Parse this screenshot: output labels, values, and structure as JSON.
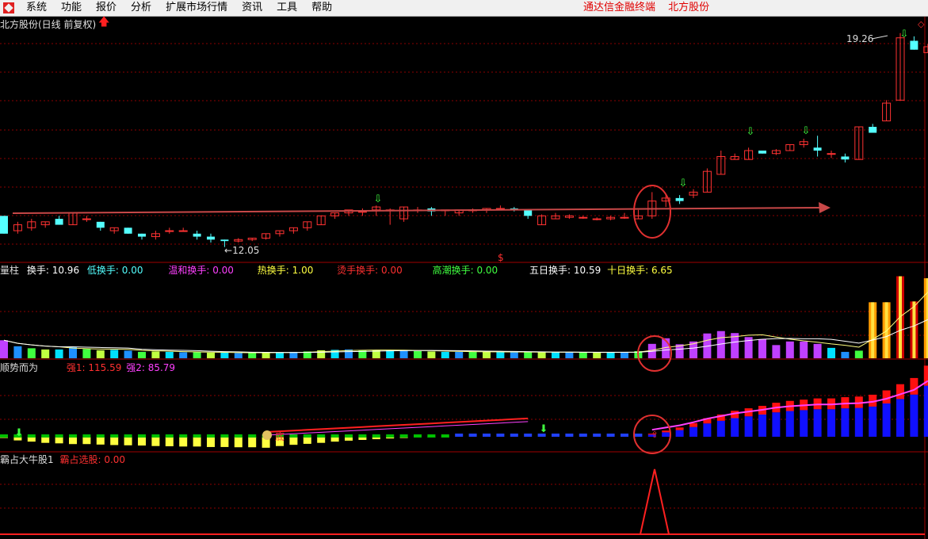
{
  "menu": {
    "items": [
      "系统",
      "功能",
      "报价",
      "分析",
      "扩展市场行情",
      "资讯",
      "工具",
      "帮助"
    ],
    "terminal_title": "通达信金融终端",
    "stock_name_title": "北方股份"
  },
  "colors": {
    "up": "#ff3232",
    "down": "#54ffff",
    "grid": "#8b0000",
    "trend_arrow": "#c84848"
  },
  "main_panel": {
    "title": "北方股份(日线 前复权)",
    "high_label": "19.26",
    "low_label": "12.05",
    "marker": "$"
  },
  "volume_panel": {
    "name": "量柱",
    "labels": [
      {
        "label": "换手:",
        "value": "10.96",
        "color": "#ffffff"
      },
      {
        "label": "低换手:",
        "value": "0.00",
        "color": "#54ffff"
      },
      {
        "label": "温和换手:",
        "value": "0.00",
        "color": "#ff40ff"
      },
      {
        "label": "热换手:",
        "value": "1.00",
        "color": "#ffff40"
      },
      {
        "label": "烫手换手:",
        "value": "0.00",
        "color": "#ff3030"
      },
      {
        "label": "高潮换手:",
        "value": "0.00",
        "color": "#40ff40"
      },
      {
        "label": "五日换手:",
        "value": "10.59",
        "color": "#ffffff"
      },
      {
        "label": "十日换手:",
        "value": "6.65",
        "color": "#ffff40"
      }
    ]
  },
  "trend_panel": {
    "name": "顺势而为",
    "strong1_label": "强1:",
    "strong1_value": "115.59",
    "strong2_label": "强2:",
    "strong2_value": "85.79",
    "tag": "底"
  },
  "bull_panel": {
    "name": "霸占大牛股1",
    "signal_label": "霸占选股:",
    "signal_value": "0.00"
  },
  "chart_data": {
    "type": "candlestick",
    "price_range": [
      11.8,
      19.6
    ],
    "series": [
      {
        "name": "price",
        "ohlc": [
          [
            13.1,
            13.1,
            12.5,
            12.5
          ],
          [
            12.6,
            12.9,
            12.5,
            12.8
          ],
          [
            12.7,
            13.0,
            12.6,
            12.9
          ],
          [
            12.8,
            12.9,
            12.7,
            12.9
          ],
          [
            13.0,
            13.1,
            12.8,
            12.8
          ],
          [
            12.8,
            13.2,
            12.8,
            13.2
          ],
          [
            13.0,
            13.1,
            12.9,
            13.0
          ],
          [
            12.9,
            12.9,
            12.6,
            12.7
          ],
          [
            12.6,
            12.7,
            12.5,
            12.7
          ],
          [
            12.7,
            12.7,
            12.5,
            12.5
          ],
          [
            12.5,
            12.5,
            12.3,
            12.4
          ],
          [
            12.4,
            12.6,
            12.3,
            12.5
          ],
          [
            12.6,
            12.7,
            12.5,
            12.6
          ],
          [
            12.6,
            12.7,
            12.6,
            12.6
          ],
          [
            12.5,
            12.6,
            12.3,
            12.4
          ],
          [
            12.4,
            12.5,
            12.2,
            12.3
          ],
          [
            12.3,
            12.3,
            12.05,
            12.25
          ],
          [
            12.25,
            12.35,
            12.2,
            12.3
          ],
          [
            12.3,
            12.35,
            12.25,
            12.35
          ],
          [
            12.35,
            12.5,
            12.3,
            12.5
          ],
          [
            12.5,
            12.6,
            12.4,
            12.6
          ],
          [
            12.6,
            12.7,
            12.5,
            12.7
          ],
          [
            12.7,
            12.9,
            12.6,
            12.9
          ],
          [
            12.8,
            13.1,
            12.8,
            13.1
          ],
          [
            13.1,
            13.2,
            13.0,
            13.2
          ],
          [
            13.2,
            13.3,
            13.1,
            13.3
          ],
          [
            13.25,
            13.35,
            13.1,
            13.25
          ],
          [
            13.3,
            13.45,
            13.1,
            13.4
          ],
          [
            13.3,
            13.35,
            12.8,
            13.3
          ],
          [
            13.0,
            13.4,
            12.9,
            13.4
          ],
          [
            13.3,
            13.4,
            13.2,
            13.3
          ],
          [
            13.35,
            13.4,
            13.1,
            13.25
          ],
          [
            13.3,
            13.3,
            13.1,
            13.3
          ],
          [
            13.2,
            13.3,
            13.1,
            13.3
          ],
          [
            13.3,
            13.35,
            13.2,
            13.3
          ],
          [
            13.3,
            13.35,
            13.2,
            13.35
          ],
          [
            13.35,
            13.45,
            13.3,
            13.35
          ],
          [
            13.35,
            13.4,
            13.25,
            13.3
          ],
          [
            13.3,
            13.3,
            13.0,
            13.1
          ],
          [
            12.8,
            13.15,
            12.8,
            13.1
          ],
          [
            13.0,
            13.2,
            13.0,
            13.1
          ],
          [
            13.05,
            13.15,
            13.0,
            13.1
          ],
          [
            13.05,
            13.1,
            13.0,
            13.05
          ],
          [
            13.0,
            13.05,
            12.95,
            13.0
          ],
          [
            13.0,
            13.1,
            12.95,
            13.05
          ],
          [
            13.05,
            13.2,
            13.0,
            13.05
          ],
          [
            13.0,
            13.3,
            13.0,
            13.1
          ],
          [
            13.1,
            13.9,
            13.0,
            13.6
          ],
          [
            13.6,
            13.8,
            13.4,
            13.7
          ],
          [
            13.7,
            13.8,
            13.5,
            13.6
          ],
          [
            13.8,
            14.0,
            13.7,
            13.9
          ],
          [
            13.9,
            14.7,
            13.9,
            14.6
          ],
          [
            14.5,
            15.3,
            14.5,
            15.1
          ],
          [
            15.0,
            15.2,
            15.0,
            15.1
          ],
          [
            15.0,
            15.4,
            15.0,
            15.3
          ],
          [
            15.3,
            15.3,
            15.2,
            15.2
          ],
          [
            15.2,
            15.35,
            15.15,
            15.3
          ],
          [
            15.3,
            15.5,
            15.3,
            15.5
          ],
          [
            15.5,
            15.7,
            15.4,
            15.6
          ],
          [
            15.4,
            15.8,
            15.1,
            15.3
          ],
          [
            15.2,
            15.3,
            15.05,
            15.2
          ],
          [
            15.1,
            15.2,
            14.9,
            15.0
          ],
          [
            15.0,
            16.1,
            15.0,
            16.1
          ],
          [
            16.1,
            16.2,
            15.9,
            15.9
          ],
          [
            16.3,
            17.0,
            16.3,
            16.9
          ],
          [
            17.0,
            19.26,
            17.0,
            19.1
          ],
          [
            19.0,
            19.15,
            18.7,
            18.7
          ],
          [
            18.6,
            18.9,
            18.6,
            18.8
          ]
        ]
      },
      {
        "name": "volume_bars",
        "values": [
          4.5,
          3.0,
          2.5,
          2.2,
          2.2,
          2.8,
          2.3,
          2.0,
          2.1,
          1.9,
          1.6,
          1.7,
          1.6,
          1.5,
          1.5,
          1.4,
          1.4,
          1.3,
          1.3,
          1.5,
          1.5,
          1.6,
          1.7,
          2.0,
          2.1,
          2.2,
          2.0,
          2.0,
          2.0,
          2.0,
          1.8,
          1.7,
          1.6,
          1.6,
          1.6,
          1.6,
          1.6,
          1.5,
          1.5,
          1.5,
          1.5,
          1.5,
          1.4,
          1.4,
          1.5,
          1.6,
          1.8,
          3.6,
          5.0,
          3.5,
          4.2,
          6.2,
          6.8,
          6.3,
          5.3,
          4.8,
          3.3,
          4.2,
          4.2,
          3.6,
          2.6,
          1.6,
          1.9,
          14.0,
          14.0,
          20.5,
          14.2,
          20.0
        ]
      },
      {
        "name": "strength_bars",
        "values": [
          -0.5,
          -1.5,
          -2,
          -2.5,
          -2.7,
          -3,
          -3,
          -3.2,
          -3.4,
          -3.5,
          -3.6,
          -3.8,
          -3.9,
          -4,
          -4,
          -4.2,
          -4.2,
          -4.3,
          -4.3,
          -4.5,
          -3.8,
          -3.3,
          -2.9,
          -2.5,
          -2.0,
          -1.6,
          -1.3,
          -1.0,
          -0.7,
          -0.5,
          -0.3,
          -0.2,
          -0.1,
          0,
          0,
          0.1,
          0.1,
          0.2,
          0.2,
          0.1,
          0.0,
          0.0,
          0.0,
          0.0,
          0.0,
          0.1,
          0.2,
          0.5,
          1.0,
          1.5,
          2.2,
          3.0,
          3.6,
          4.2,
          4.6,
          5.0,
          5.5,
          5.8,
          6.0,
          6.2,
          6.2,
          6.4,
          6.5,
          6.8,
          7.5,
          8.5,
          9.5,
          11.5
        ]
      }
    ]
  }
}
